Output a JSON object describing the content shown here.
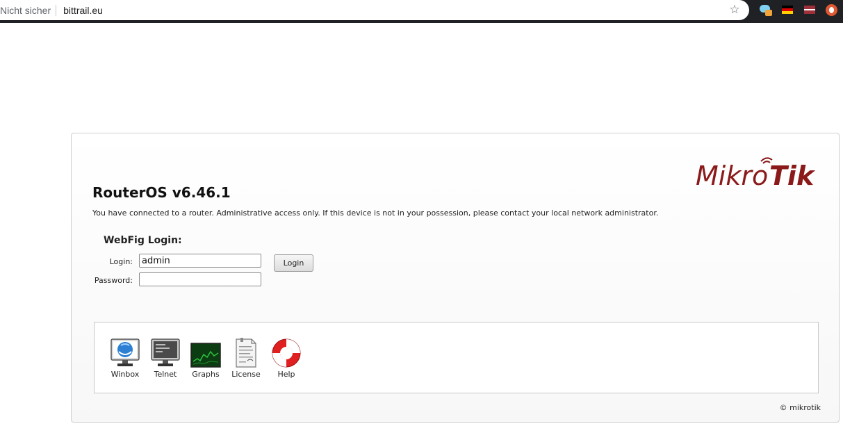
{
  "browser": {
    "security_label": "Nicht sicher",
    "url": "bittrail.eu",
    "bookmark_icon": "star-icon",
    "extensions": [
      "cloud-extension-icon",
      "german-flag-icon",
      "latvian-flag-icon",
      "duckduckgo-icon"
    ]
  },
  "brand": {
    "logo_text_thin": "Mikro",
    "logo_text_bold": "Tik",
    "logo_color": "#8b1a1a"
  },
  "page": {
    "title": "RouterOS v6.46.1",
    "notice": "You have connected to a router. Administrative access only. If this device is not in your possession, please contact your local network administrator."
  },
  "login_form": {
    "heading": "WebFig Login:",
    "login_label": "Login:",
    "login_value": "admin",
    "password_label": "Password:",
    "password_value": "",
    "submit_label": "Login"
  },
  "tools": [
    {
      "label": "Winbox",
      "icon": "winbox-icon"
    },
    {
      "label": "Telnet",
      "icon": "telnet-icon"
    },
    {
      "label": "Graphs",
      "icon": "graphs-icon"
    },
    {
      "label": "License",
      "icon": "license-icon"
    },
    {
      "label": "Help",
      "icon": "help-icon"
    }
  ],
  "footer": {
    "copyright": "© mikrotik"
  }
}
